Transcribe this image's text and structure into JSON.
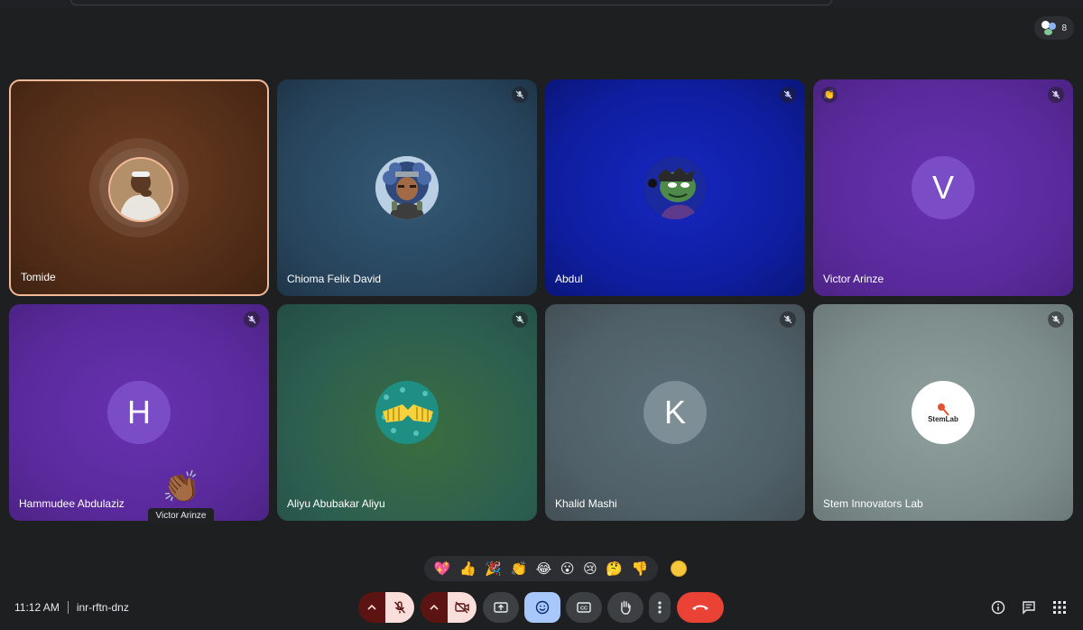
{
  "meeting": {
    "time": "11:12 AM",
    "code": "inr-rftn-dnz",
    "participant_count": "8"
  },
  "participants": [
    {
      "name": "Tomide",
      "muted": false,
      "bg": "#5a3117",
      "avatar_type": "photo"
    },
    {
      "name": "Chioma Felix David",
      "muted": true,
      "bg": "#2a4a63",
      "avatar_type": "image"
    },
    {
      "name": "Abdul",
      "muted": true,
      "bg": "#0f1ea0",
      "avatar_type": "image"
    },
    {
      "name": "Victor Arinze",
      "muted": true,
      "bg": "#5a2a9c",
      "avatar_type": "letter",
      "letter": "V"
    },
    {
      "name": "Hammudee Abdulaziz",
      "muted": true,
      "bg": "#5a2a9c",
      "avatar_type": "letter",
      "letter": "H"
    },
    {
      "name": "Aliyu Abubakar Aliyu",
      "muted": true,
      "bg": "#2a5b4e",
      "avatar_type": "image"
    },
    {
      "name": "Khalid Mashi",
      "muted": true,
      "bg": "#4f6068",
      "avatar_type": "letter",
      "letter": "K"
    },
    {
      "name": "Stem Innovators Lab",
      "muted": true,
      "bg": "#7d8d8c",
      "avatar_type": "logo",
      "logo_text": "StemLab"
    }
  ],
  "reaction_overlay": {
    "emoji": "👏🏾",
    "sender": "Victor Arinze"
  },
  "reactions": [
    "💖",
    "👍",
    "🎉",
    "👏",
    "😂",
    "😮",
    "😢",
    "🤔",
    "👎"
  ],
  "colors": {
    "background": "#1e1f20",
    "active_speaker_border": "#f4b996",
    "end_call": "#ea4335",
    "muted_control": "#f9dedc",
    "muted_control_arrow": "#5b1412",
    "active_reaction": "#a8c7fa"
  },
  "controls": [
    {
      "id": "mic-options",
      "icon": "chevron-up-icon"
    },
    {
      "id": "mic",
      "icon": "mic-off-icon"
    },
    {
      "id": "camera-options",
      "icon": "chevron-up-icon"
    },
    {
      "id": "camera",
      "icon": "camera-off-icon"
    },
    {
      "id": "present",
      "icon": "present-screen-icon"
    },
    {
      "id": "reactions",
      "icon": "emoji-icon"
    },
    {
      "id": "captions",
      "icon": "captions-icon"
    },
    {
      "id": "raise-hand",
      "icon": "hand-icon"
    },
    {
      "id": "more-options",
      "icon": "more-vert-icon"
    },
    {
      "id": "leave-call",
      "icon": "phone-hangup-icon"
    }
  ],
  "right_controls": [
    {
      "id": "meeting-details",
      "icon": "info-icon"
    },
    {
      "id": "chat",
      "icon": "chat-icon"
    },
    {
      "id": "activities",
      "icon": "apps-grid-icon"
    }
  ]
}
